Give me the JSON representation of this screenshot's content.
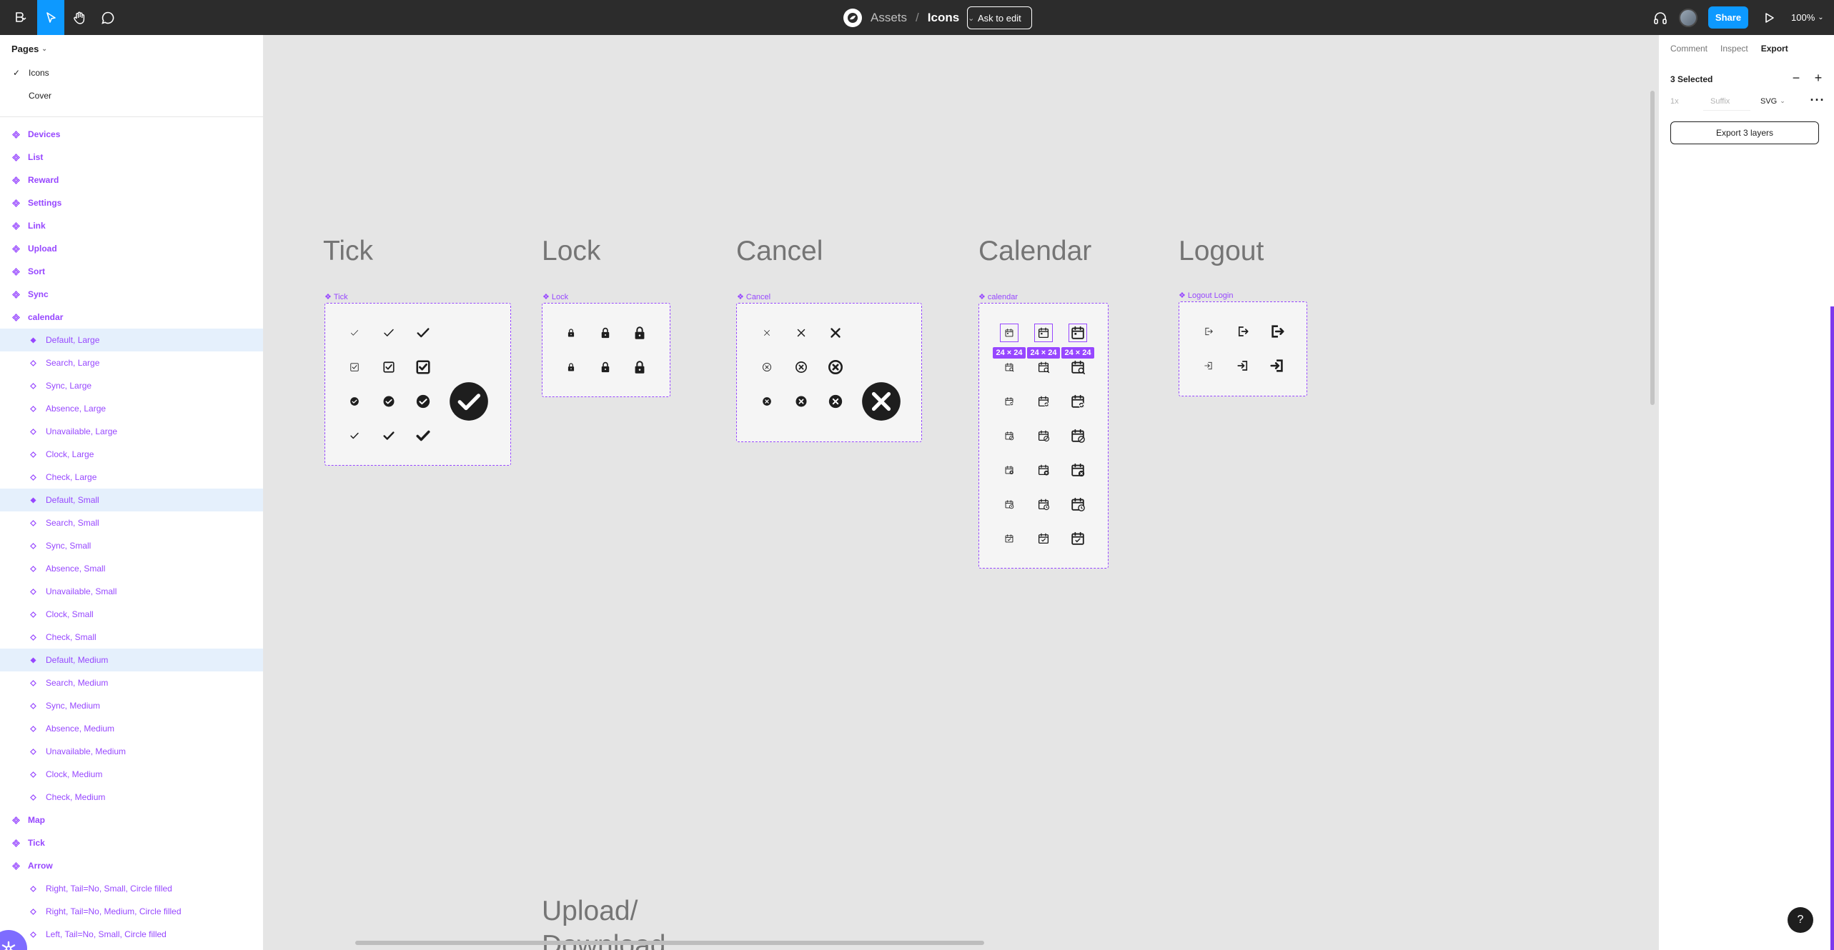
{
  "topbar": {
    "project": "Assets",
    "separator": "/",
    "file": "Icons",
    "ask_to_edit": "Ask to edit",
    "share": "Share",
    "zoom": "100%",
    "icons": [
      "figma-menu-icon",
      "move-tool-icon",
      "hand-tool-icon",
      "comment-tool-icon",
      "headphones-icon",
      "play-icon"
    ]
  },
  "pages": {
    "header": "Pages",
    "items": [
      {
        "label": "Icons",
        "current": true
      },
      {
        "label": "Cover",
        "current": false
      }
    ]
  },
  "layers": [
    {
      "label": "Devices",
      "level": 0,
      "selected": false
    },
    {
      "label": "List",
      "level": 0,
      "selected": false
    },
    {
      "label": "Reward",
      "level": 0,
      "selected": false
    },
    {
      "label": "Settings",
      "level": 0,
      "selected": false
    },
    {
      "label": "Link",
      "level": 0,
      "selected": false
    },
    {
      "label": "Upload",
      "level": 0,
      "selected": false
    },
    {
      "label": "Sort",
      "level": 0,
      "selected": false
    },
    {
      "label": "Sync",
      "level": 0,
      "selected": false
    },
    {
      "label": "calendar",
      "level": 0,
      "selected": false
    },
    {
      "label": "Default, Large",
      "level": 1,
      "selected": true
    },
    {
      "label": "Search, Large",
      "level": 1,
      "selected": false
    },
    {
      "label": "Sync, Large",
      "level": 1,
      "selected": false
    },
    {
      "label": "Absence, Large",
      "level": 1,
      "selected": false
    },
    {
      "label": "Unavailable, Large",
      "level": 1,
      "selected": false
    },
    {
      "label": "Clock, Large",
      "level": 1,
      "selected": false
    },
    {
      "label": "Check, Large",
      "level": 1,
      "selected": false
    },
    {
      "label": "Default, Small",
      "level": 1,
      "selected": true
    },
    {
      "label": "Search, Small",
      "level": 1,
      "selected": false
    },
    {
      "label": "Sync, Small",
      "level": 1,
      "selected": false
    },
    {
      "label": "Absence, Small",
      "level": 1,
      "selected": false
    },
    {
      "label": "Unavailable, Small",
      "level": 1,
      "selected": false
    },
    {
      "label": "Clock, Small",
      "level": 1,
      "selected": false
    },
    {
      "label": "Check, Small",
      "level": 1,
      "selected": false
    },
    {
      "label": "Default, Medium",
      "level": 1,
      "selected": true
    },
    {
      "label": "Search, Medium",
      "level": 1,
      "selected": false
    },
    {
      "label": "Sync, Medium",
      "level": 1,
      "selected": false
    },
    {
      "label": "Absence, Medium",
      "level": 1,
      "selected": false
    },
    {
      "label": "Unavailable, Medium",
      "level": 1,
      "selected": false
    },
    {
      "label": "Clock, Medium",
      "level": 1,
      "selected": false
    },
    {
      "label": "Check, Medium",
      "level": 1,
      "selected": false
    },
    {
      "label": "Map",
      "level": 0,
      "selected": false
    },
    {
      "label": "Tick",
      "level": 0,
      "selected": false
    },
    {
      "label": "Arrow",
      "level": 0,
      "selected": false
    },
    {
      "label": "Right, Tail=No, Small, Circle filled",
      "level": 1,
      "selected": false
    },
    {
      "label": "Right, Tail=No, Medium, Circle filled",
      "level": 1,
      "selected": false
    },
    {
      "label": "Left, Tail=No, Small, Circle filled",
      "level": 1,
      "selected": false
    }
  ],
  "canvas": {
    "sections": {
      "tick": {
        "title": "Tick",
        "frame_label": "Tick"
      },
      "lock": {
        "title": "Lock",
        "frame_label": "Lock"
      },
      "cancel": {
        "title": "Cancel",
        "frame_label": "Cancel"
      },
      "calendar": {
        "title": "Calendar",
        "frame_label": "calendar"
      },
      "logout": {
        "title": "Logout",
        "frame_label": "Logout Login"
      },
      "upload": {
        "title": "Upload/ Download"
      }
    },
    "size_badge": "24 × 24"
  },
  "right_panel": {
    "tabs": [
      "Comment",
      "Inspect",
      "Export"
    ],
    "active_tab": "Export",
    "selected_count": "3 Selected",
    "scale": "1x",
    "suffix_placeholder": "Suffix",
    "format": "SVG",
    "export_button": "Export 3 layers",
    "help": "?"
  },
  "colors": {
    "accent_purple": "#9747ff",
    "brand_blue": "#0d99ff",
    "topbar_bg": "#2c2c2c",
    "selection_bg": "#e5f0fc",
    "canvas_bg": "#e5e5e5"
  }
}
